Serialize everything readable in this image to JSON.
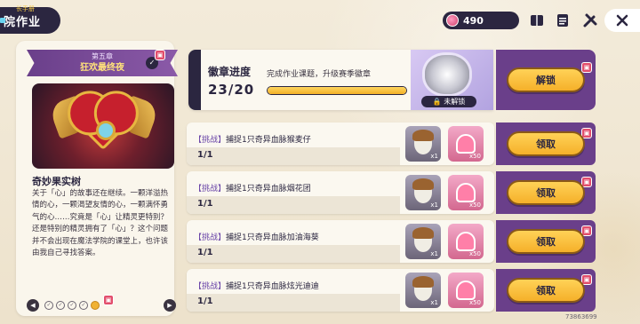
{
  "header": {
    "title": "院作业",
    "title_sup": "长手册"
  },
  "currency": {
    "amount": "490",
    "icon": "gem-icon"
  },
  "top_icons": [
    "book-icon",
    "clipboard-icon",
    "tools-icon",
    "close-icon"
  ],
  "chapter": {
    "number": "第五章",
    "name": "狂欢最终夜",
    "card_title": "奇妙果实树",
    "description": "关于「心」的故事还在继续。一颗洋溢热情的心，一颗渴望友情的心，一颗满怀勇气的心……究竟是「心」让精灵更特别？还是特别的精灵拥有了「心」？这个问题并不会出现在魔法学院的课堂上，也许该由我自己寻找答案。",
    "pager_total": 5,
    "pager_active": 4
  },
  "badge": {
    "title": "徽章进度",
    "description": "完成作业课题，升级赛季徽章",
    "count": "23/20",
    "progress": 1.0,
    "locked_label": "未解锁",
    "unlock_label": "解锁"
  },
  "tasks": [
    {
      "tag": "【挑战】",
      "text": "捕捉1只奇异血脉猴麦仔",
      "count": "1/1",
      "reward1_qty": "x1",
      "reward2_qty": "x50",
      "claim_label": "领取"
    },
    {
      "tag": "【挑战】",
      "text": "捕捉1只奇异血脉烟花团",
      "count": "1/1",
      "reward1_qty": "x1",
      "reward2_qty": "x50",
      "claim_label": "领取"
    },
    {
      "tag": "【挑战】",
      "text": "捕捉1只奇异血脉加油海葵",
      "count": "1/1",
      "reward1_qty": "x1",
      "reward2_qty": "x50",
      "claim_label": "领取"
    },
    {
      "tag": "【挑战】",
      "text": "捕捉1只奇异血脉炫光迪迪",
      "count": "1/1",
      "reward1_qty": "x1",
      "reward2_qty": "x50",
      "claim_label": "领取"
    }
  ],
  "footer": {
    "id": "73863699"
  },
  "colors": {
    "dark": "#2b2640",
    "purple": "#6a3f8a",
    "yellow": "#f5b02a",
    "card": "#fbf8f0"
  }
}
